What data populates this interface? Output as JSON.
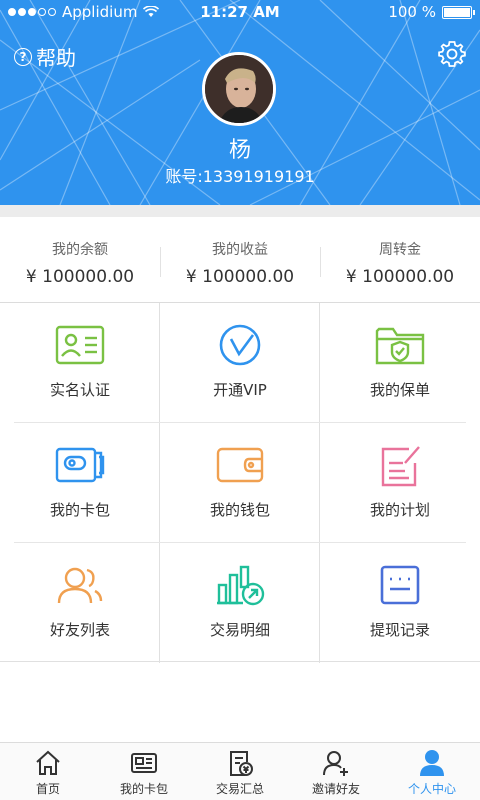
{
  "status_bar": {
    "carrier": "Applidium",
    "time": "11:27 AM",
    "battery": "100 %"
  },
  "header": {
    "help_label": "帮助",
    "user_name": "杨",
    "account": "账号:13391919191",
    "bg_color": "#2f93ee"
  },
  "balances": [
    {
      "label": "我的余额",
      "value": "¥ 100000.00"
    },
    {
      "label": "我的收益",
      "value": "¥ 100000.00"
    },
    {
      "label": "周转金",
      "value": "¥ 100000.00"
    }
  ],
  "grid": [
    {
      "label": "实名认证",
      "icon": "id-card-icon",
      "color": "#7ac143"
    },
    {
      "label": "开通VIP",
      "icon": "vip-icon",
      "color": "#2f93ee"
    },
    {
      "label": "我的保单",
      "icon": "folder-shield-icon",
      "color": "#7ac143"
    },
    {
      "label": "我的卡包",
      "icon": "card-wallet-icon",
      "color": "#2f93ee"
    },
    {
      "label": "我的钱包",
      "icon": "wallet-icon",
      "color": "#f0a050"
    },
    {
      "label": "我的计划",
      "icon": "edit-note-icon",
      "color": "#e9739b"
    },
    {
      "label": "好友列表",
      "icon": "friends-icon",
      "color": "#f0a050"
    },
    {
      "label": "交易明细",
      "icon": "chart-detail-icon",
      "color": "#1fbf9a"
    },
    {
      "label": "提现记录",
      "icon": "record-icon",
      "color": "#4a6fd8"
    }
  ],
  "tabbar": [
    {
      "label": "首页",
      "icon": "home-icon",
      "active": false
    },
    {
      "label": "我的卡包",
      "icon": "card-icon",
      "active": false
    },
    {
      "label": "交易汇总",
      "icon": "summary-icon",
      "active": false
    },
    {
      "label": "邀请好友",
      "icon": "invite-icon",
      "active": false
    },
    {
      "label": "个人中心",
      "icon": "profile-icon",
      "active": true
    }
  ],
  "colors": {
    "accent": "#2f93ee"
  }
}
